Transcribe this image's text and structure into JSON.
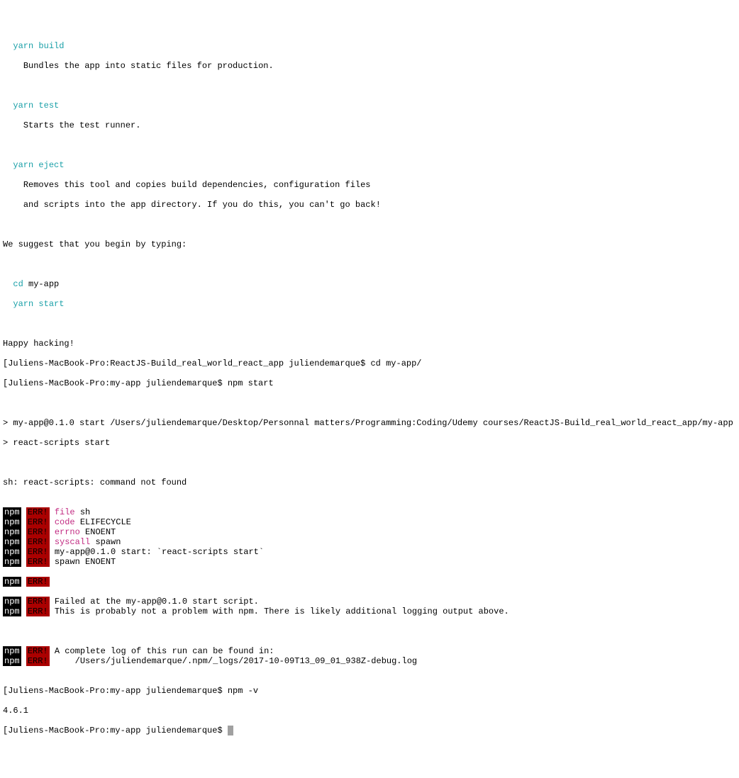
{
  "intro": {
    "yarn_build": "yarn build",
    "yarn_build_desc": "Bundles the app into static files for production.",
    "yarn_test": "yarn test",
    "yarn_test_desc": "Starts the test runner.",
    "yarn_eject": "yarn eject",
    "yarn_eject_desc1": "Removes this tool and copies build dependencies, configuration files",
    "yarn_eject_desc2": "and scripts into the app directory. If you do this, you can't go back!",
    "suggest": "We suggest that you begin by typing:",
    "cd_cmd": "cd ",
    "cd_arg": "my-app",
    "yarn_start": "yarn start",
    "happy": "Happy hacking!"
  },
  "prompts": {
    "p1": "[Juliens-MacBook-Pro:ReactJS-Build_real_world_react_app juliendemarque$ cd my-app/",
    "p2": "[Juliens-MacBook-Pro:my-app juliendemarque$ npm start",
    "p3": "[Juliens-MacBook-Pro:my-app juliendemarque$ npm -v",
    "p4": "[Juliens-MacBook-Pro:my-app juliendemarque$ "
  },
  "run": {
    "line1": "> my-app@0.1.0 start /Users/juliendemarque/Desktop/Personnal matters/Programming:Coding/Udemy courses/ReactJS-Build_real_world_react_app/my-app",
    "line2": "> react-scripts start",
    "sh_err": "sh: react-scripts: command not found"
  },
  "npm_errors": [
    {
      "key": "file",
      "val": " sh"
    },
    {
      "key": "code",
      "val": " ELIFECYCLE"
    },
    {
      "key": "errno",
      "val": " ENOENT"
    },
    {
      "key": "syscall",
      "val": " spawn"
    },
    {
      "key": "",
      "val": "my-app@0.1.0 start: `react-scripts start`"
    },
    {
      "key": "",
      "val": "spawn ENOENT"
    }
  ],
  "npm_errors2": [
    {
      "key": "",
      "val": "Failed at the my-app@0.1.0 start script."
    },
    {
      "key": "",
      "val": "This is probably not a problem with npm. There is likely additional logging output above."
    }
  ],
  "npm_errors3": [
    {
      "key": "",
      "val": "A complete log of this run can be found in:"
    },
    {
      "key": "",
      "val": "    /Users/juliendemarque/.npm/_logs/2017-10-09T13_09_01_938Z-debug.log"
    }
  ],
  "npm_version": "4.6.1",
  "labels": {
    "npm": "npm",
    "err": "ERR!"
  }
}
